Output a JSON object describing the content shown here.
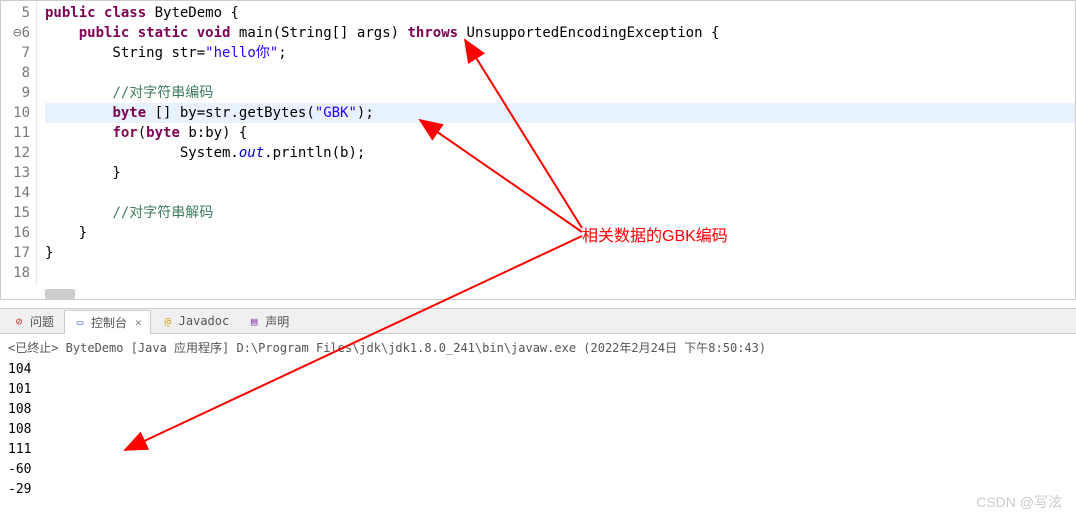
{
  "editor": {
    "lines": [
      {
        "n": 5,
        "tokens": [
          {
            "t": "public ",
            "c": "kw"
          },
          {
            "t": "class ",
            "c": "kw"
          },
          {
            "t": "ByteDemo {",
            "c": ""
          }
        ]
      },
      {
        "n": 6,
        "marker": "⊖",
        "tokens": [
          {
            "t": "    ",
            "c": ""
          },
          {
            "t": "public ",
            "c": "kw"
          },
          {
            "t": "static ",
            "c": "kw"
          },
          {
            "t": "void ",
            "c": "kw"
          },
          {
            "t": "main(String[] ",
            "c": ""
          },
          {
            "t": "args",
            "c": "type"
          },
          {
            "t": ") ",
            "c": ""
          },
          {
            "t": "throws ",
            "c": "kw"
          },
          {
            "t": "UnsupportedEncodingException {",
            "c": ""
          }
        ]
      },
      {
        "n": 7,
        "tokens": [
          {
            "t": "        String ",
            "c": ""
          },
          {
            "t": "str",
            "c": "type"
          },
          {
            "t": "=",
            "c": ""
          },
          {
            "t": "\"hello你\"",
            "c": "str"
          },
          {
            "t": ";",
            "c": ""
          }
        ]
      },
      {
        "n": 8,
        "tokens": []
      },
      {
        "n": 9,
        "tokens": [
          {
            "t": "        ",
            "c": ""
          },
          {
            "t": "//对字符串编码",
            "c": "comment"
          }
        ]
      },
      {
        "n": 10,
        "highlight": true,
        "tokens": [
          {
            "t": "        ",
            "c": ""
          },
          {
            "t": "byte",
            "c": "kw"
          },
          {
            "t": " [] ",
            "c": ""
          },
          {
            "t": "by",
            "c": "type"
          },
          {
            "t": "=",
            "c": ""
          },
          {
            "t": "str",
            "c": "type"
          },
          {
            "t": ".getBytes(",
            "c": ""
          },
          {
            "t": "\"GBK\"",
            "c": "str"
          },
          {
            "t": ");",
            "c": ""
          }
        ]
      },
      {
        "n": 11,
        "tokens": [
          {
            "t": "        ",
            "c": ""
          },
          {
            "t": "for",
            "c": "kw"
          },
          {
            "t": "(",
            "c": ""
          },
          {
            "t": "byte",
            "c": "kw"
          },
          {
            "t": " ",
            "c": ""
          },
          {
            "t": "b",
            "c": "type"
          },
          {
            "t": ":",
            "c": ""
          },
          {
            "t": "by",
            "c": "type"
          },
          {
            "t": ") {",
            "c": ""
          }
        ]
      },
      {
        "n": 12,
        "tokens": [
          {
            "t": "                System.",
            "c": ""
          },
          {
            "t": "out",
            "c": "field"
          },
          {
            "t": ".println(",
            "c": ""
          },
          {
            "t": "b",
            "c": "type"
          },
          {
            "t": ");",
            "c": ""
          }
        ]
      },
      {
        "n": 13,
        "tokens": [
          {
            "t": "        }",
            "c": ""
          }
        ]
      },
      {
        "n": 14,
        "tokens": []
      },
      {
        "n": 15,
        "tokens": [
          {
            "t": "        ",
            "c": ""
          },
          {
            "t": "//对字符串解码",
            "c": "comment"
          }
        ]
      },
      {
        "n": 16,
        "tokens": [
          {
            "t": "    }",
            "c": ""
          }
        ]
      },
      {
        "n": 17,
        "tokens": [
          {
            "t": "}",
            "c": ""
          }
        ]
      },
      {
        "n": 18,
        "tokens": []
      }
    ]
  },
  "annotation": {
    "label": "相关数据的GBK编码"
  },
  "tabs": {
    "problems": "问题",
    "console": "控制台",
    "javadoc": "Javadoc",
    "declaration": "声明"
  },
  "console": {
    "header": "<已终止> ByteDemo [Java 应用程序] D:\\Program Files\\jdk\\jdk1.8.0_241\\bin\\javaw.exe  (2022年2月24日 下午8:50:43)",
    "output": [
      "104",
      "101",
      "108",
      "108",
      "111",
      "-60",
      "-29"
    ]
  },
  "watermark": "CSDN @写泫"
}
